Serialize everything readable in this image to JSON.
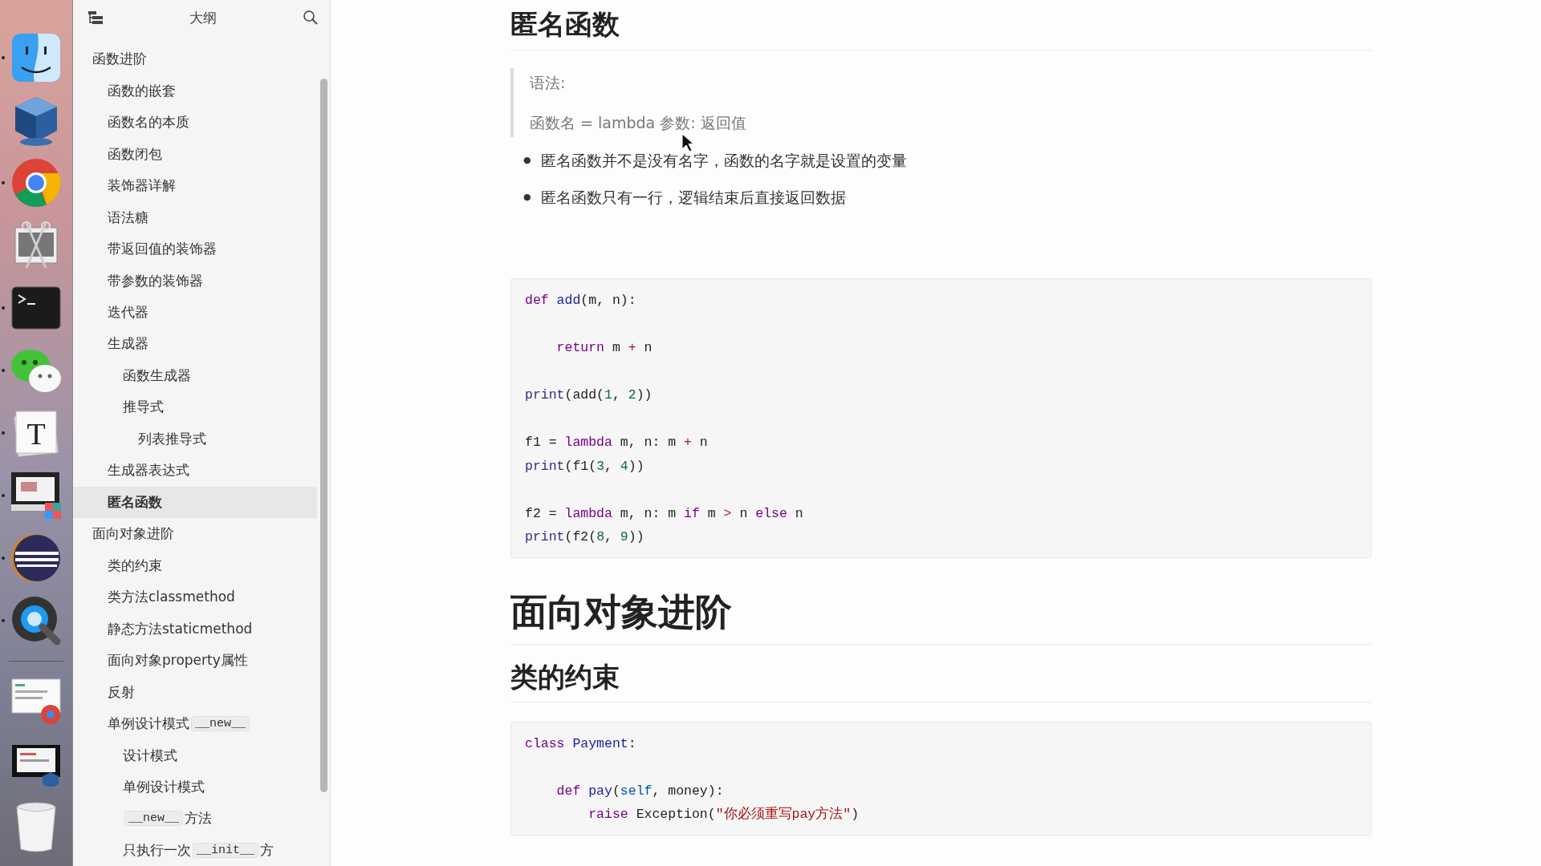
{
  "dock": [
    {
      "kind": "finder",
      "running": true
    },
    {
      "kind": "cube",
      "running": false
    },
    {
      "kind": "chrome",
      "running": true
    },
    {
      "kind": "scissors",
      "running": false
    },
    {
      "kind": "terminal",
      "running": true
    },
    {
      "kind": "chat",
      "running": true
    },
    {
      "kind": "paper",
      "glyph": "T",
      "running": true
    },
    {
      "kind": "monitor",
      "running": true
    },
    {
      "kind": "eclipse",
      "running": true
    },
    {
      "kind": "quicktime",
      "running": true
    },
    {
      "kind": "separator"
    },
    {
      "kind": "doc-chrome",
      "running": false
    },
    {
      "kind": "doc-cube",
      "running": false
    },
    {
      "kind": "trash",
      "running": false
    }
  ],
  "outline": {
    "title": "大纲",
    "items": [
      {
        "parts": [
          {
            "kind": "text",
            "text": "函数进阶"
          }
        ],
        "selected": false,
        "children": [
          {
            "parts": [
              {
                "kind": "text",
                "text": "函数的嵌套"
              }
            ],
            "selected": false
          },
          {
            "parts": [
              {
                "kind": "text",
                "text": "函数名的本质"
              }
            ],
            "selected": false
          },
          {
            "parts": [
              {
                "kind": "text",
                "text": "函数闭包"
              }
            ],
            "selected": false
          },
          {
            "parts": [
              {
                "kind": "text",
                "text": "装饰器详解"
              }
            ],
            "selected": false
          },
          {
            "parts": [
              {
                "kind": "text",
                "text": "语法糖"
              }
            ],
            "selected": false
          },
          {
            "parts": [
              {
                "kind": "text",
                "text": "带返回值的装饰器"
              }
            ],
            "selected": false
          },
          {
            "parts": [
              {
                "kind": "text",
                "text": "带参数的装饰器"
              }
            ],
            "selected": false
          },
          {
            "parts": [
              {
                "kind": "text",
                "text": "迭代器"
              }
            ],
            "selected": false
          },
          {
            "parts": [
              {
                "kind": "text",
                "text": "生成器"
              }
            ],
            "selected": false,
            "children": [
              {
                "parts": [
                  {
                    "kind": "text",
                    "text": "函数生成器"
                  }
                ],
                "selected": false
              },
              {
                "parts": [
                  {
                    "kind": "text",
                    "text": "推导式"
                  }
                ],
                "selected": false,
                "children": [
                  {
                    "parts": [
                      {
                        "kind": "text",
                        "text": "列表推导式"
                      }
                    ],
                    "selected": false
                  }
                ]
              }
            ]
          },
          {
            "parts": [
              {
                "kind": "text",
                "text": "生成器表达式"
              }
            ],
            "selected": false
          },
          {
            "parts": [
              {
                "kind": "text",
                "text": "匿名函数"
              }
            ],
            "selected": true
          }
        ]
      },
      {
        "parts": [
          {
            "kind": "text",
            "text": "面向对象进阶"
          }
        ],
        "selected": false,
        "children": [
          {
            "parts": [
              {
                "kind": "text",
                "text": "类的约束"
              }
            ],
            "selected": false
          },
          {
            "parts": [
              {
                "kind": "text",
                "text": "类方法classmethod"
              }
            ],
            "selected": false
          },
          {
            "parts": [
              {
                "kind": "text",
                "text": "静态方法staticmethod"
              }
            ],
            "selected": false
          },
          {
            "parts": [
              {
                "kind": "text",
                "text": "面向对象property属性"
              }
            ],
            "selected": false
          },
          {
            "parts": [
              {
                "kind": "text",
                "text": "反射"
              }
            ],
            "selected": false
          },
          {
            "parts": [
              {
                "kind": "text",
                "text": "单例设计模式"
              },
              {
                "kind": "code",
                "text": "__new__"
              }
            ],
            "selected": false,
            "children": [
              {
                "parts": [
                  {
                    "kind": "text",
                    "text": "设计模式"
                  }
                ],
                "selected": false
              },
              {
                "parts": [
                  {
                    "kind": "text",
                    "text": "单例设计模式"
                  }
                ],
                "selected": false
              },
              {
                "parts": [
                  {
                    "kind": "code",
                    "text": "__new__"
                  },
                  {
                    "kind": "text",
                    "text": "方法"
                  }
                ],
                "selected": false
              },
              {
                "parts": [
                  {
                    "kind": "text",
                    "text": "只执行一次"
                  },
                  {
                    "kind": "code",
                    "text": "__init__"
                  },
                  {
                    "kind": "text",
                    "text": "方"
                  }
                ],
                "selected": false
              }
            ]
          }
        ]
      }
    ]
  },
  "document": {
    "blocks": [
      {
        "kind": "h1",
        "text": "匿名函数",
        "large": false
      },
      {
        "kind": "quote",
        "lines": [
          "语法:",
          "函数名 = lambda 参数: 返回值"
        ]
      },
      {
        "kind": "bullets",
        "marker": "●",
        "items": [
          "匿名函数并不是没有名字，函数的名字就是设置的变量",
          "匿名函数只有一行，逻辑结束后直接返回数据"
        ]
      },
      {
        "kind": "code",
        "lines": [
          {
            "blank_before": false,
            "tokens": [
              {
                "kind": "kw",
                "text": "def"
              },
              {
                "kind": "def",
                "text": " add"
              },
              {
                "kind": "plain",
                "text": "(m, n):"
              }
            ]
          },
          {
            "blank_before": true,
            "tokens": [
              {
                "kind": "kw",
                "text": "    return"
              },
              {
                "kind": "plain",
                "text": " m "
              },
              {
                "kind": "op",
                "text": "+"
              },
              {
                "kind": "plain",
                "text": " n"
              }
            ]
          },
          {
            "blank_before": true,
            "tokens": [
              {
                "kind": "builtin",
                "text": "print"
              },
              {
                "kind": "plain",
                "text": "(add("
              },
              {
                "kind": "num",
                "text": "1"
              },
              {
                "kind": "plain",
                "text": ", "
              },
              {
                "kind": "num",
                "text": "2"
              },
              {
                "kind": "plain",
                "text": "))"
              }
            ]
          },
          {
            "blank_before": true,
            "tokens": [
              {
                "kind": "plain",
                "text": "f1 = "
              },
              {
                "kind": "kw",
                "text": "lambda"
              },
              {
                "kind": "plain",
                "text": " m, n: m "
              },
              {
                "kind": "op",
                "text": "+"
              },
              {
                "kind": "plain",
                "text": " n"
              }
            ]
          },
          {
            "blank_before": false,
            "tokens": [
              {
                "kind": "builtin",
                "text": "print"
              },
              {
                "kind": "plain",
                "text": "(f1("
              },
              {
                "kind": "num",
                "text": "3"
              },
              {
                "kind": "plain",
                "text": ", "
              },
              {
                "kind": "num",
                "text": "4"
              },
              {
                "kind": "plain",
                "text": "))"
              }
            ]
          },
          {
            "blank_before": true,
            "tokens": [
              {
                "kind": "plain",
                "text": "f2 = "
              },
              {
                "kind": "kw",
                "text": "lambda"
              },
              {
                "kind": "plain",
                "text": " m, n: m "
              },
              {
                "kind": "kw",
                "text": "if"
              },
              {
                "kind": "plain",
                "text": " m "
              },
              {
                "kind": "op",
                "text": ">"
              },
              {
                "kind": "plain",
                "text": " n "
              },
              {
                "kind": "kw",
                "text": "else"
              },
              {
                "kind": "plain",
                "text": " n"
              }
            ]
          },
          {
            "blank_before": false,
            "tokens": [
              {
                "kind": "builtin",
                "text": "print"
              },
              {
                "kind": "plain",
                "text": "(f2("
              },
              {
                "kind": "num",
                "text": "8"
              },
              {
                "kind": "plain",
                "text": ", "
              },
              {
                "kind": "num",
                "text": "9"
              },
              {
                "kind": "plain",
                "text": "))"
              }
            ]
          }
        ]
      },
      {
        "kind": "h1",
        "text": "面向对象进阶",
        "large": true
      },
      {
        "kind": "h2",
        "text": "类的约束"
      },
      {
        "kind": "code",
        "lines": [
          {
            "blank_before": false,
            "tokens": [
              {
                "kind": "kw",
                "text": "class"
              },
              {
                "kind": "def",
                "text": " Payment"
              },
              {
                "kind": "plain",
                "text": ":"
              }
            ]
          },
          {
            "blank_before": true,
            "tokens": [
              {
                "kind": "kw",
                "text": "    def"
              },
              {
                "kind": "def",
                "text": " pay"
              },
              {
                "kind": "plain",
                "text": "("
              },
              {
                "kind": "var2",
                "text": "self"
              },
              {
                "kind": "plain",
                "text": ", money):"
              }
            ]
          },
          {
            "blank_before": false,
            "tokens": [
              {
                "kind": "kw",
                "text": "        raise"
              },
              {
                "kind": "plain",
                "text": " Exception("
              },
              {
                "kind": "str",
                "text": "\"你必须重写pay方法\""
              },
              {
                "kind": "plain",
                "text": ")"
              }
            ]
          }
        ]
      }
    ]
  }
}
